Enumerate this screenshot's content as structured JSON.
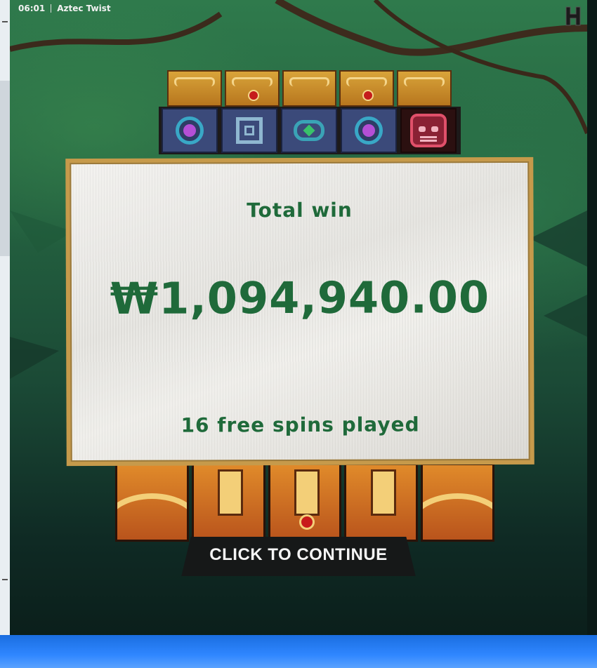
{
  "title_bar": {
    "time": "06:01",
    "game_name": "Aztec Twist"
  },
  "brand_icon": "studio-logo-icon",
  "reel_symbols_top": [
    "purple-orb-icon",
    "square-glyph-icon",
    "green-gem-icon",
    "purple-orb-icon",
    "red-mask-icon"
  ],
  "win_panel": {
    "label": "Total win",
    "amount": "₩1,094,940.00",
    "spins_text": "16 free spins played"
  },
  "continue_button": {
    "label": "CLICK TO CONTINUE"
  },
  "colors": {
    "win_text": "#1f6a3a",
    "jungle_green": "#2f7a4c",
    "frame_gold": "#c69a4b"
  }
}
